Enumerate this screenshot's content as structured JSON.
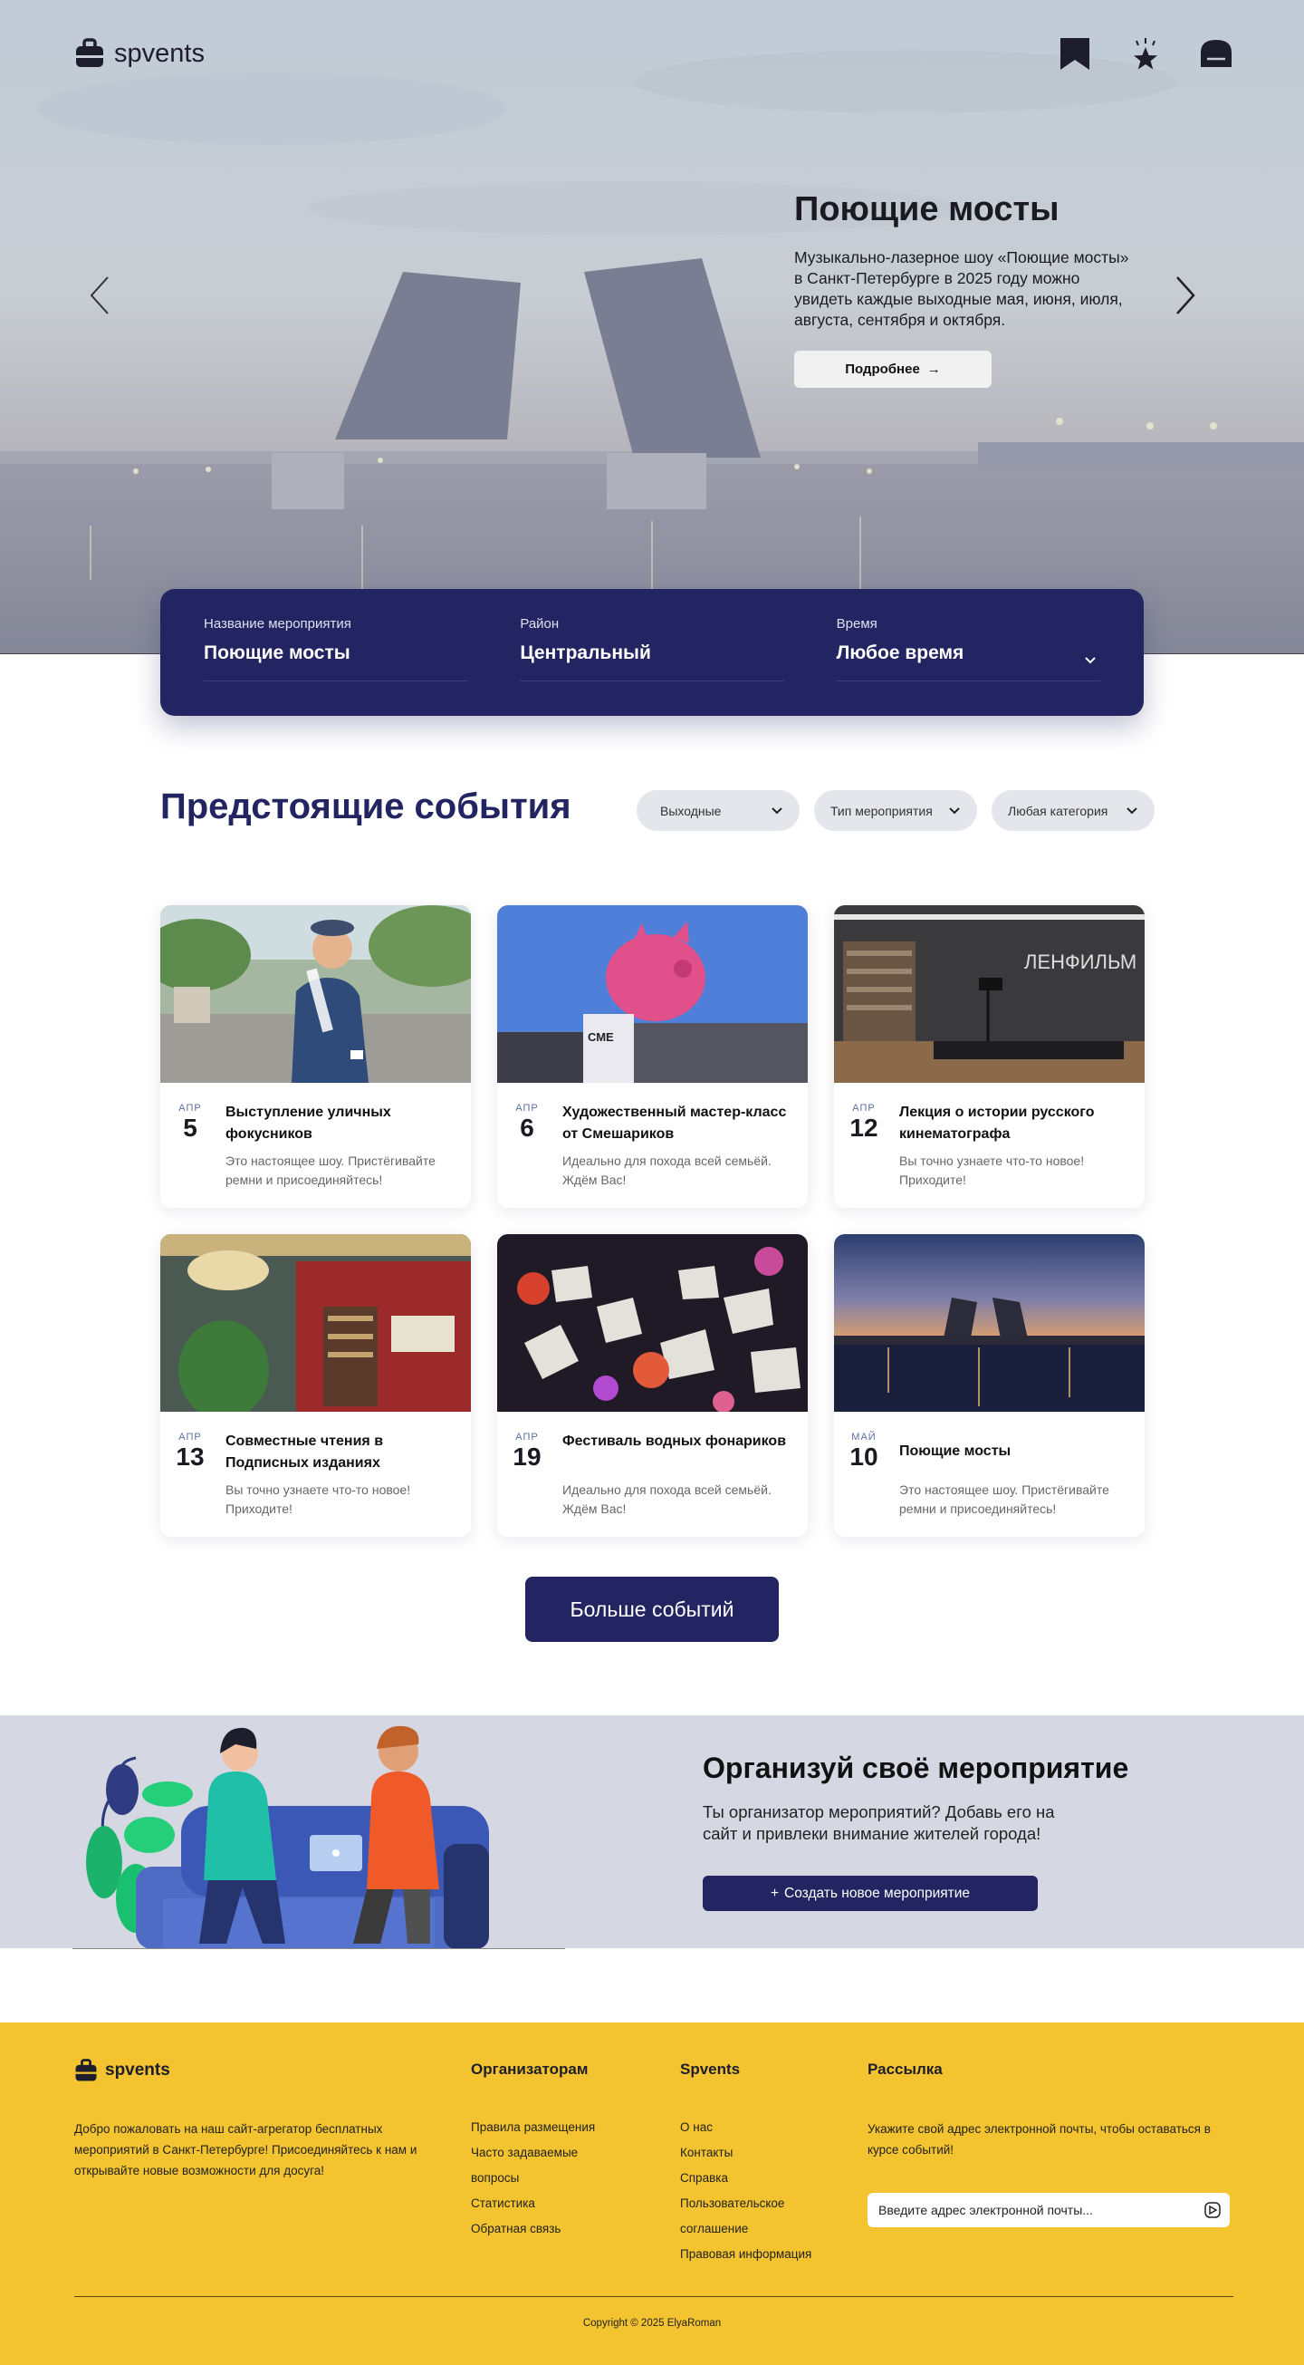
{
  "brand": {
    "name": "spvents"
  },
  "header": {
    "icons": [
      "bookmark-icon",
      "star-icon",
      "home-icon"
    ]
  },
  "hero": {
    "title": "Поющие мосты",
    "description": "Музыкально-лазерное шоу «Поющие мосты» в Санкт-Петербурге в 2025 году можно увидеть каждые выходные мая, июня, июля, августа, сентября и октября.",
    "button_label": "Подробнее",
    "button_icon": "→"
  },
  "search": {
    "name_label": "Название мероприятия",
    "name_value": "Поющие мосты",
    "district_label": "Район",
    "district_value": "Центральный",
    "time_label": "Время",
    "time_value": "Любое время"
  },
  "events": {
    "title": "Предстоящие события",
    "filters": [
      "Выходные",
      "Тип мероприятия",
      "Любая категория"
    ],
    "cards": [
      {
        "month": "АПР",
        "day": "5",
        "title": "Выступление уличных фокусников",
        "desc": "Это настоящее шоу. Пристёгивайте ремни и присоединяйтесь!"
      },
      {
        "month": "АПР",
        "day": "6",
        "title": "Художественный мастер-класс от Смешариков",
        "desc": "Идеально для похода всей семьёй. Ждём Вас!"
      },
      {
        "month": "АПР",
        "day": "12",
        "title": "Лекция о истории русского кинематографа",
        "desc": "Вы точно узнаете что-то новое! Приходите!"
      },
      {
        "month": "АПР",
        "day": "13",
        "title": "Совместные чтения в Подписных изданиях",
        "desc": "Вы точно узнаете что-то новое! Приходите!"
      },
      {
        "month": "АПР",
        "day": "19",
        "title": "Фестиваль водных фонариков",
        "desc": "Идеально для похода всей семьёй. Ждём Вас!"
      },
      {
        "month": "МАЙ",
        "day": "10",
        "title": "Поющие мосты",
        "desc": "Это настоящее шоу. Пристёгивайте ремни и присоединяйтесь!"
      }
    ],
    "image_texts": {
      "smeshariki": "СМЕ ШАР ИКИ",
      "lenfilm": "ЛЕНФИЛЬМ"
    },
    "more_label": "Больше событий"
  },
  "organize": {
    "title": "Организуй своё мероприятие",
    "desc": "Ты организатор мероприятий? Добавь его на сайт и привлеки внимание жителей города!",
    "button_label": "Создать новое мероприятие",
    "button_icon": "+"
  },
  "footer": {
    "about": "Добро пожаловать на наш сайт-агрегатор бесплатных мероприятий в Санкт-Петербурге! Присоединяйтесь к нам и открывайте новые возможности для досуга!",
    "col1_title": "Организаторам",
    "col1_links": [
      "Правила размещения",
      "Часто задаваемые вопросы",
      "Статистика",
      "Обратная связь"
    ],
    "col2_title": "Spvents",
    "col2_links": [
      "О нас",
      "Контакты",
      "Справка",
      "Пользовательское соглашение",
      "Правовая информация"
    ],
    "col3_title": "Рассылка",
    "newsletter_text": "Укажите свой адрес электронной почты, чтобы оставаться в курсе событий!",
    "email_placeholder": "Введите адрес электронной почты...",
    "copyright": "Copyright © 2025 ElyaRoman"
  },
  "colors": {
    "navy": "#232462",
    "yellow": "#f3c330",
    "light_bg": "#d5d7e3"
  }
}
